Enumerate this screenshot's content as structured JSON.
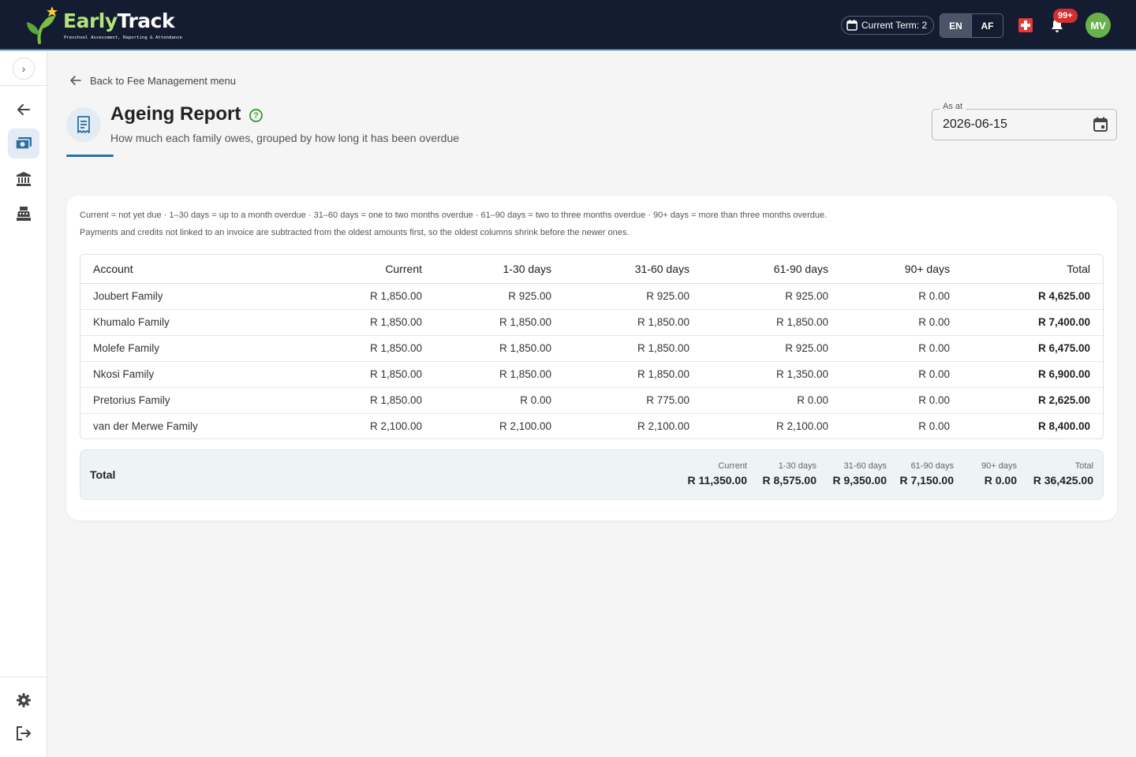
{
  "app": {
    "logo_text_early": "Early",
    "logo_text_track": "Track",
    "logo_tagline": "Preschool Assessment, Reporting & Attendance"
  },
  "header": {
    "term_label": "Current Term: 2",
    "lang_en": "EN",
    "lang_af": "AF",
    "notification_count": "99+",
    "avatar_initials": "MV",
    "colors": {
      "bar": "#131c30",
      "avatar": "#6ab04c",
      "badge": "#d32f2f"
    }
  },
  "sidebar": {
    "items": [
      {
        "icon": "arrow-back-icon"
      },
      {
        "icon": "money-icon",
        "active": true
      },
      {
        "icon": "bank-icon"
      },
      {
        "icon": "cash-register-icon"
      }
    ],
    "bottom": [
      {
        "icon": "gear-icon"
      },
      {
        "icon": "logout-icon"
      }
    ]
  },
  "page": {
    "back_link": "Back to Fee Management menu",
    "title": "Ageing Report",
    "subtitle": "How much each family owes, grouped by how long it has been overdue",
    "date_label": "As at",
    "date_value": "2026-06-15"
  },
  "notes": {
    "line1": "Current = not yet due · 1–30 days = up to a month overdue · 31–60 days = one to two months overdue · 61–90 days = two to three months overdue · 90+ days = more than three months overdue.",
    "line2": "Payments and credits not linked to an invoice are subtracted from the oldest amounts first, so the oldest columns shrink before the newer ones."
  },
  "table": {
    "headers": [
      "Account",
      "Current",
      "1-30 days",
      "31-60 days",
      "61-90 days",
      "90+ days",
      "Total"
    ],
    "rows": [
      [
        "Joubert Family",
        "R 1,850.00",
        "R 925.00",
        "R 925.00",
        "R 925.00",
        "R 0.00",
        "R 4,625.00"
      ],
      [
        "Khumalo Family",
        "R 1,850.00",
        "R 1,850.00",
        "R 1,850.00",
        "R 1,850.00",
        "R 0.00",
        "R 7,400.00"
      ],
      [
        "Molefe Family",
        "R 1,850.00",
        "R 1,850.00",
        "R 1,850.00",
        "R 925.00",
        "R 0.00",
        "R 6,475.00"
      ],
      [
        "Nkosi Family",
        "R 1,850.00",
        "R 1,850.00",
        "R 1,850.00",
        "R 1,350.00",
        "R 0.00",
        "R 6,900.00"
      ],
      [
        "Pretorius Family",
        "R 1,850.00",
        "R 0.00",
        "R 775.00",
        "R 0.00",
        "R 0.00",
        "R 2,625.00"
      ],
      [
        "van der Merwe Family",
        "R 2,100.00",
        "R 2,100.00",
        "R 2,100.00",
        "R 2,100.00",
        "R 0.00",
        "R 8,400.00"
      ]
    ]
  },
  "totals": {
    "label": "Total",
    "items": [
      {
        "caption": "Current",
        "value": "R 11,350.00"
      },
      {
        "caption": "1-30 days",
        "value": "R 8,575.00"
      },
      {
        "caption": "31-60 days",
        "value": "R 9,350.00"
      },
      {
        "caption": "61-90 days",
        "value": "R 7,150.00"
      },
      {
        "caption": "90+ days",
        "value": "R 0.00"
      },
      {
        "caption": "Total",
        "value": "R 36,425.00"
      }
    ]
  }
}
